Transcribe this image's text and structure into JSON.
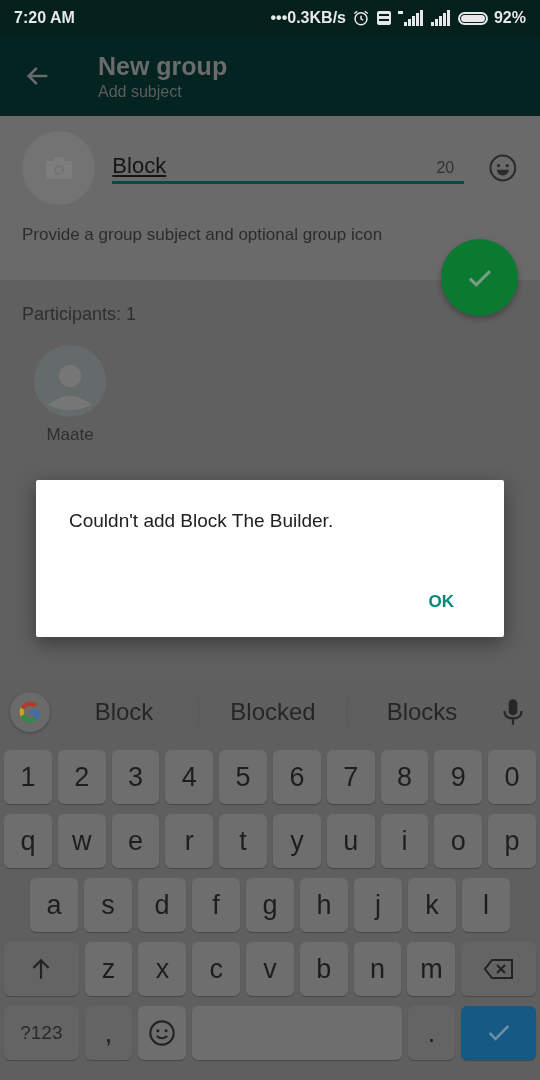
{
  "status_bar": {
    "time": "7:20 AM",
    "net_speed": "•••0.3KB/s",
    "battery": "92%"
  },
  "header": {
    "title": "New group",
    "subtitle": "Add subject"
  },
  "subject": {
    "value": "Block",
    "remaining": "20",
    "hint": "Provide a group subject and optional group icon"
  },
  "participants": {
    "label": "Participants: 1",
    "people": [
      {
        "name": "Maate"
      }
    ]
  },
  "dialog": {
    "message": "Couldn't add Block The Builder.",
    "button": "OK"
  },
  "keyboard": {
    "suggestions": [
      "Block",
      "Blocked",
      "Blocks"
    ],
    "rows": [
      [
        {
          "kind": "char",
          "label": "1"
        },
        {
          "kind": "char",
          "label": "2"
        },
        {
          "kind": "char",
          "label": "3"
        },
        {
          "kind": "char",
          "label": "4"
        },
        {
          "kind": "char",
          "label": "5"
        },
        {
          "kind": "char",
          "label": "6"
        },
        {
          "kind": "char",
          "label": "7"
        },
        {
          "kind": "char",
          "label": "8"
        },
        {
          "kind": "char",
          "label": "9"
        },
        {
          "kind": "char",
          "label": "0"
        }
      ],
      [
        {
          "kind": "char",
          "label": "q"
        },
        {
          "kind": "char",
          "label": "w"
        },
        {
          "kind": "char",
          "label": "e"
        },
        {
          "kind": "char",
          "label": "r"
        },
        {
          "kind": "char",
          "label": "t"
        },
        {
          "kind": "char",
          "label": "y"
        },
        {
          "kind": "char",
          "label": "u"
        },
        {
          "kind": "char",
          "label": "i"
        },
        {
          "kind": "char",
          "label": "o"
        },
        {
          "kind": "char",
          "label": "p"
        }
      ],
      [
        {
          "kind": "char",
          "label": "a"
        },
        {
          "kind": "char",
          "label": "s"
        },
        {
          "kind": "char",
          "label": "d"
        },
        {
          "kind": "char",
          "label": "f"
        },
        {
          "kind": "char",
          "label": "g"
        },
        {
          "kind": "char",
          "label": "h"
        },
        {
          "kind": "char",
          "label": "j"
        },
        {
          "kind": "char",
          "label": "k"
        },
        {
          "kind": "char",
          "label": "l"
        }
      ],
      [
        {
          "kind": "shift"
        },
        {
          "kind": "char",
          "label": "z"
        },
        {
          "kind": "char",
          "label": "x"
        },
        {
          "kind": "char",
          "label": "c"
        },
        {
          "kind": "char",
          "label": "v"
        },
        {
          "kind": "char",
          "label": "b"
        },
        {
          "kind": "char",
          "label": "n"
        },
        {
          "kind": "char",
          "label": "m"
        },
        {
          "kind": "backspace"
        }
      ],
      [
        {
          "kind": "symbols",
          "label": "?123"
        },
        {
          "kind": "comma",
          "label": ","
        },
        {
          "kind": "emoji"
        },
        {
          "kind": "space"
        },
        {
          "kind": "period",
          "label": "."
        },
        {
          "kind": "enter"
        }
      ]
    ]
  }
}
